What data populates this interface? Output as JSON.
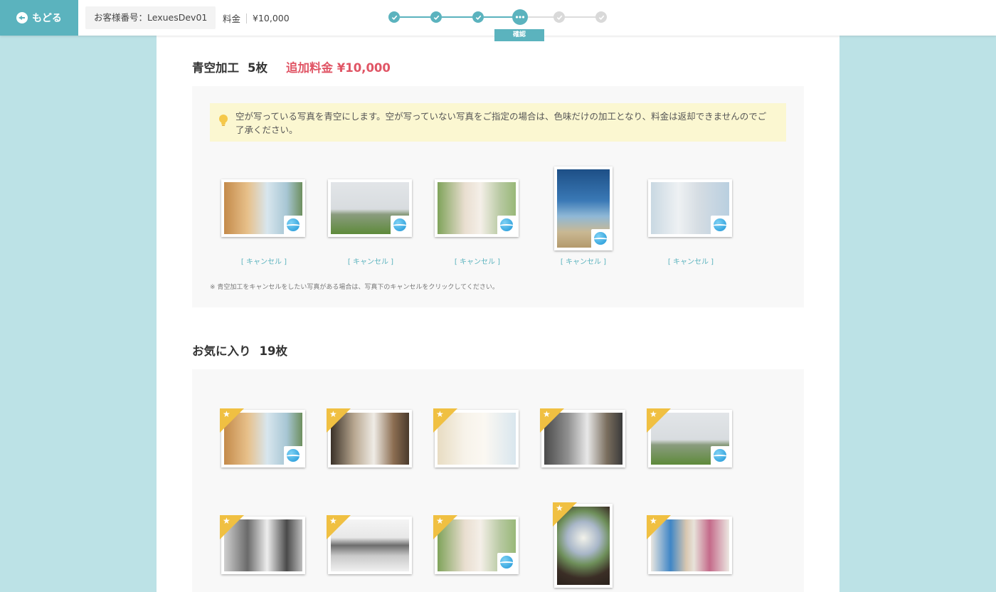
{
  "header": {
    "back_label": "もどる",
    "customer_label": "お客様番号：LexuesDev01",
    "fee_label": "料金",
    "fee_value": "¥10,000",
    "current_step_label": "確認"
  },
  "progress": {
    "steps": [
      "done",
      "done",
      "done",
      "current",
      "todo",
      "todo"
    ]
  },
  "bluesky": {
    "title": "青空加工",
    "count": "5枚",
    "extra_fee": "追加料金 ¥10,000",
    "notice": "空が写っている写真を青空にします。空が写っていない写真をご指定の場合は、色味だけの加工となり、料金は返却できませんのでご了承ください。",
    "cancel_label": "[ キャンセル ]",
    "footnote": "※ 青空加工をキャンセルをしたい写真がある場合は、写真下のキャンセルをクリックしてください。"
  },
  "favorites": {
    "title": "お気に入り",
    "count": "19枚"
  },
  "colors": {
    "accent": "#5bb3be",
    "extra_fee": "#e05565",
    "star": "#f0c042",
    "notice_bg": "#fbf7d1"
  },
  "icons": {
    "back": "arrow-left-circle-icon",
    "bulb": "lightbulb-icon",
    "bluesky": "bluesky-badge-icon",
    "favorite": "star-corner-icon",
    "check": "check-icon",
    "more": "ellipsis-icon"
  }
}
